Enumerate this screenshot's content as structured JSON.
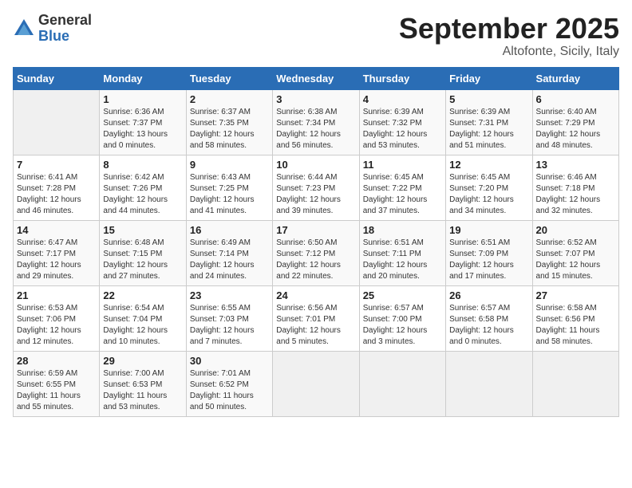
{
  "header": {
    "logo_general": "General",
    "logo_blue": "Blue",
    "month_title": "September 2025",
    "location": "Altofonte, Sicily, Italy"
  },
  "calendar": {
    "days_of_week": [
      "Sunday",
      "Monday",
      "Tuesday",
      "Wednesday",
      "Thursday",
      "Friday",
      "Saturday"
    ],
    "weeks": [
      [
        {
          "day": "",
          "content": ""
        },
        {
          "day": "1",
          "content": "Sunrise: 6:36 AM\nSunset: 7:37 PM\nDaylight: 13 hours\nand 0 minutes."
        },
        {
          "day": "2",
          "content": "Sunrise: 6:37 AM\nSunset: 7:35 PM\nDaylight: 12 hours\nand 58 minutes."
        },
        {
          "day": "3",
          "content": "Sunrise: 6:38 AM\nSunset: 7:34 PM\nDaylight: 12 hours\nand 56 minutes."
        },
        {
          "day": "4",
          "content": "Sunrise: 6:39 AM\nSunset: 7:32 PM\nDaylight: 12 hours\nand 53 minutes."
        },
        {
          "day": "5",
          "content": "Sunrise: 6:39 AM\nSunset: 7:31 PM\nDaylight: 12 hours\nand 51 minutes."
        },
        {
          "day": "6",
          "content": "Sunrise: 6:40 AM\nSunset: 7:29 PM\nDaylight: 12 hours\nand 48 minutes."
        }
      ],
      [
        {
          "day": "7",
          "content": "Sunrise: 6:41 AM\nSunset: 7:28 PM\nDaylight: 12 hours\nand 46 minutes."
        },
        {
          "day": "8",
          "content": "Sunrise: 6:42 AM\nSunset: 7:26 PM\nDaylight: 12 hours\nand 44 minutes."
        },
        {
          "day": "9",
          "content": "Sunrise: 6:43 AM\nSunset: 7:25 PM\nDaylight: 12 hours\nand 41 minutes."
        },
        {
          "day": "10",
          "content": "Sunrise: 6:44 AM\nSunset: 7:23 PM\nDaylight: 12 hours\nand 39 minutes."
        },
        {
          "day": "11",
          "content": "Sunrise: 6:45 AM\nSunset: 7:22 PM\nDaylight: 12 hours\nand 37 minutes."
        },
        {
          "day": "12",
          "content": "Sunrise: 6:45 AM\nSunset: 7:20 PM\nDaylight: 12 hours\nand 34 minutes."
        },
        {
          "day": "13",
          "content": "Sunrise: 6:46 AM\nSunset: 7:18 PM\nDaylight: 12 hours\nand 32 minutes."
        }
      ],
      [
        {
          "day": "14",
          "content": "Sunrise: 6:47 AM\nSunset: 7:17 PM\nDaylight: 12 hours\nand 29 minutes."
        },
        {
          "day": "15",
          "content": "Sunrise: 6:48 AM\nSunset: 7:15 PM\nDaylight: 12 hours\nand 27 minutes."
        },
        {
          "day": "16",
          "content": "Sunrise: 6:49 AM\nSunset: 7:14 PM\nDaylight: 12 hours\nand 24 minutes."
        },
        {
          "day": "17",
          "content": "Sunrise: 6:50 AM\nSunset: 7:12 PM\nDaylight: 12 hours\nand 22 minutes."
        },
        {
          "day": "18",
          "content": "Sunrise: 6:51 AM\nSunset: 7:11 PM\nDaylight: 12 hours\nand 20 minutes."
        },
        {
          "day": "19",
          "content": "Sunrise: 6:51 AM\nSunset: 7:09 PM\nDaylight: 12 hours\nand 17 minutes."
        },
        {
          "day": "20",
          "content": "Sunrise: 6:52 AM\nSunset: 7:07 PM\nDaylight: 12 hours\nand 15 minutes."
        }
      ],
      [
        {
          "day": "21",
          "content": "Sunrise: 6:53 AM\nSunset: 7:06 PM\nDaylight: 12 hours\nand 12 minutes."
        },
        {
          "day": "22",
          "content": "Sunrise: 6:54 AM\nSunset: 7:04 PM\nDaylight: 12 hours\nand 10 minutes."
        },
        {
          "day": "23",
          "content": "Sunrise: 6:55 AM\nSunset: 7:03 PM\nDaylight: 12 hours\nand 7 minutes."
        },
        {
          "day": "24",
          "content": "Sunrise: 6:56 AM\nSunset: 7:01 PM\nDaylight: 12 hours\nand 5 minutes."
        },
        {
          "day": "25",
          "content": "Sunrise: 6:57 AM\nSunset: 7:00 PM\nDaylight: 12 hours\nand 3 minutes."
        },
        {
          "day": "26",
          "content": "Sunrise: 6:57 AM\nSunset: 6:58 PM\nDaylight: 12 hours\nand 0 minutes."
        },
        {
          "day": "27",
          "content": "Sunrise: 6:58 AM\nSunset: 6:56 PM\nDaylight: 11 hours\nand 58 minutes."
        }
      ],
      [
        {
          "day": "28",
          "content": "Sunrise: 6:59 AM\nSunset: 6:55 PM\nDaylight: 11 hours\nand 55 minutes."
        },
        {
          "day": "29",
          "content": "Sunrise: 7:00 AM\nSunset: 6:53 PM\nDaylight: 11 hours\nand 53 minutes."
        },
        {
          "day": "30",
          "content": "Sunrise: 7:01 AM\nSunset: 6:52 PM\nDaylight: 11 hours\nand 50 minutes."
        },
        {
          "day": "",
          "content": ""
        },
        {
          "day": "",
          "content": ""
        },
        {
          "day": "",
          "content": ""
        },
        {
          "day": "",
          "content": ""
        }
      ]
    ]
  }
}
